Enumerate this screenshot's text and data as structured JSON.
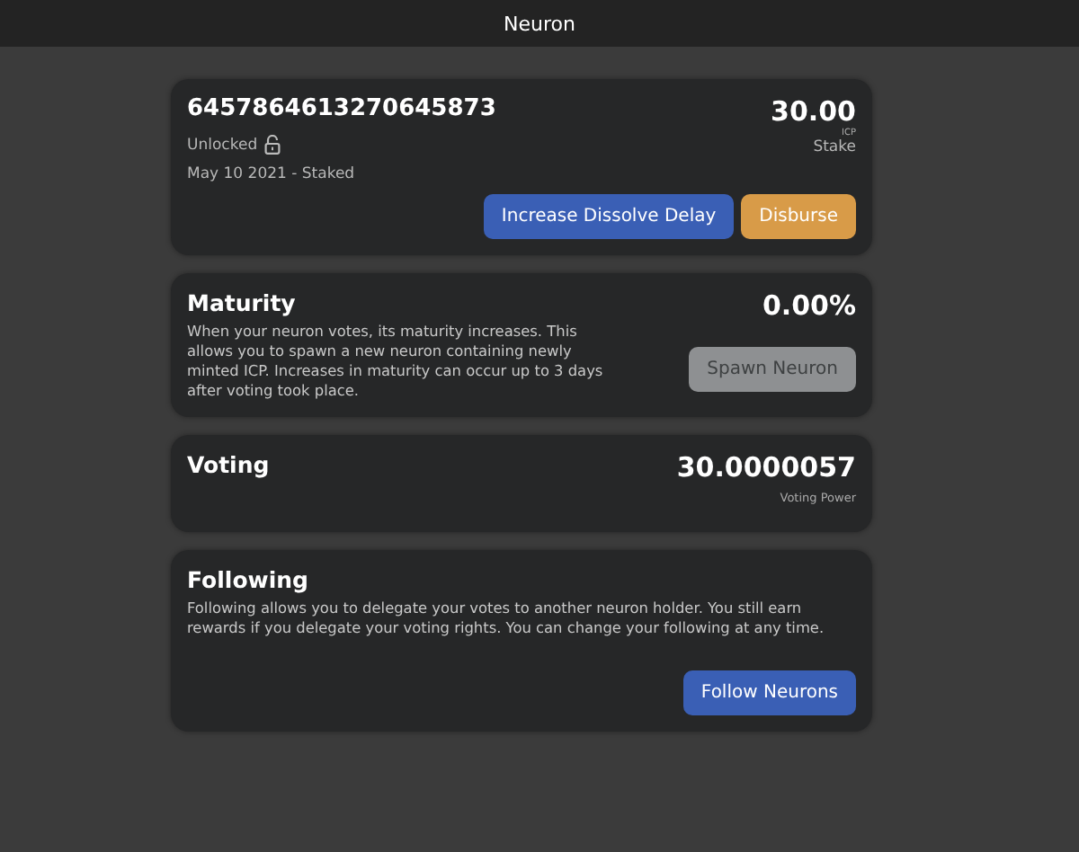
{
  "window": {
    "title": "Neuron"
  },
  "neuron": {
    "id": "6457864613270645873",
    "lock_state": "Unlocked",
    "locked": false,
    "date": "May 10 2021 - Staked",
    "amount": "30.00",
    "unit": "ICP",
    "amount_label": "Stake",
    "buttons": [
      {
        "label": "Increase Dissolve Delay",
        "kind": "primary",
        "disabled": false
      },
      {
        "label": "Disburse",
        "kind": "warning",
        "disabled": false
      }
    ]
  },
  "maturity": {
    "title": "Maturity",
    "value": "0.00%",
    "description": "When your neuron votes, its maturity increases. This allows you to spawn a new neuron containing newly minted ICP. Increases in maturity can occur up to 3 days after voting took place.",
    "button": {
      "label": "Spawn Neuron",
      "kind": "primary",
      "disabled": true
    }
  },
  "voting": {
    "title": "Voting",
    "value": "30.0000057",
    "value_label": "Voting Power"
  },
  "following": {
    "title": "Following",
    "description": "Following allows you to delegate your votes to another neuron holder. You still earn rewards if you delegate your voting rights. You can change your following at any time.",
    "button": {
      "label": "Follow Neurons",
      "kind": "primary",
      "disabled": false
    }
  }
}
